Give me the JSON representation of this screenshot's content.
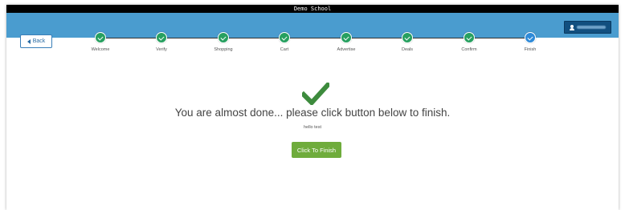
{
  "window": {
    "title": "Demo School"
  },
  "header": {
    "user_name": "Robert Adams"
  },
  "nav": {
    "back_label": "Back"
  },
  "steps": [
    {
      "label": "Welcome",
      "status": "done"
    },
    {
      "label": "Verify",
      "status": "done"
    },
    {
      "label": "Shopping",
      "status": "done"
    },
    {
      "label": "Cart",
      "status": "done"
    },
    {
      "label": "Advertise",
      "status": "done"
    },
    {
      "label": "Deals",
      "status": "done"
    },
    {
      "label": "Confirm",
      "status": "done"
    },
    {
      "label": "Finish",
      "status": "current"
    }
  ],
  "main": {
    "heading": "You are almost done... please click button below to finish.",
    "subtext": "hello test",
    "finish_button_label": "Click To Finish"
  },
  "colors": {
    "header_bar": "#4a9ccf",
    "step_done": "#27a060",
    "step_current": "#2e8ad8",
    "finish_button": "#6fac3c",
    "check_icon": "#3d8b3d"
  }
}
